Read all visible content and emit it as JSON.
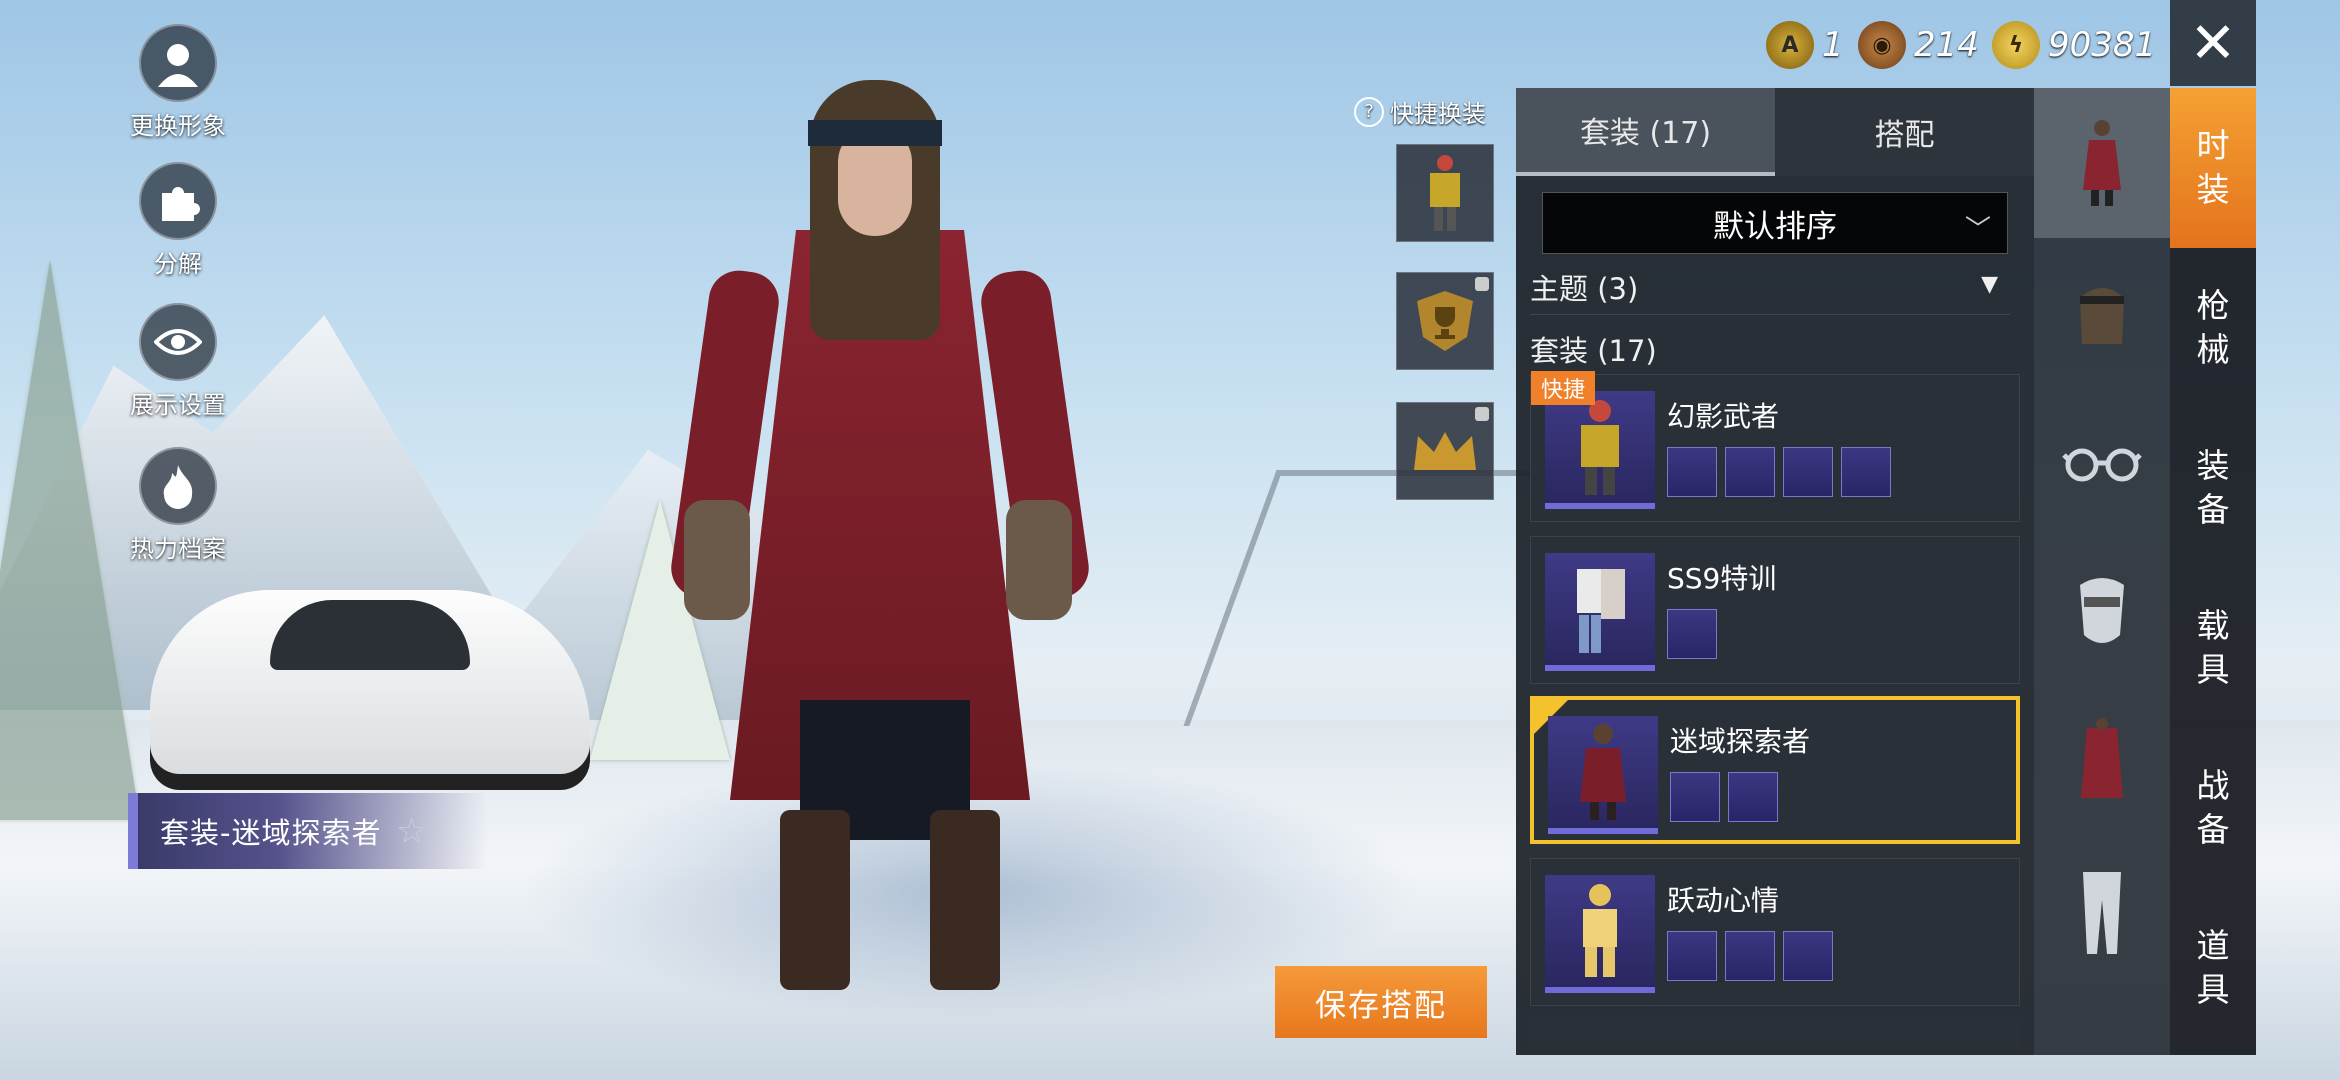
{
  "left_menu": [
    {
      "label": "更换形象",
      "icon": "avatar-icon"
    },
    {
      "label": "分解",
      "icon": "puzzle-icon"
    },
    {
      "label": "展示设置",
      "icon": "eye-icon"
    },
    {
      "label": "热力档案",
      "icon": "flame-icon"
    }
  ],
  "outfit_banner": {
    "label": "套装-迷域探索者",
    "icon": "star-icon"
  },
  "save_button": "保存搭配",
  "quick_swap": {
    "label": "快捷换装",
    "icon": "question-icon"
  },
  "currency": [
    {
      "icon": "ag-coin-icon",
      "value": "1"
    },
    {
      "icon": "bp-coin-icon",
      "value": "214"
    },
    {
      "icon": "uc-coin-icon",
      "value": "90381"
    }
  ],
  "tabs": [
    {
      "label": "套装 (17)",
      "active": true
    },
    {
      "label": "搭配",
      "active": false
    }
  ],
  "sort": {
    "label": "默认排序"
  },
  "sections": {
    "theme": "主题 (3)",
    "suit": "套装 (17)"
  },
  "cards": [
    {
      "name": "幻影武者",
      "badge": "快捷",
      "selected": false,
      "item_count": 4
    },
    {
      "name": "SS9特训",
      "badge": "",
      "selected": false,
      "item_count": 1
    },
    {
      "name": "迷域探索者",
      "badge": "",
      "selected": true,
      "item_count": 2
    },
    {
      "name": "跃动心情",
      "badge": "",
      "selected": false,
      "item_count": 3
    }
  ],
  "categories": [
    "outfit-icon",
    "hat-icon",
    "glasses-icon",
    "mask-icon",
    "top-icon",
    "pants-icon"
  ],
  "side_tabs": [
    {
      "label": "时\n装",
      "active": true
    },
    {
      "label": "枪\n械",
      "active": false
    },
    {
      "label": "装\n备",
      "active": false
    },
    {
      "label": "载\n具",
      "active": false
    },
    {
      "label": "战\n备",
      "active": false
    },
    {
      "label": "道\n具",
      "active": false
    }
  ],
  "colors": {
    "accent_orange": "#f08a2a",
    "selected_yellow": "#f3c22c",
    "item_purple": "#6f6bd9"
  }
}
